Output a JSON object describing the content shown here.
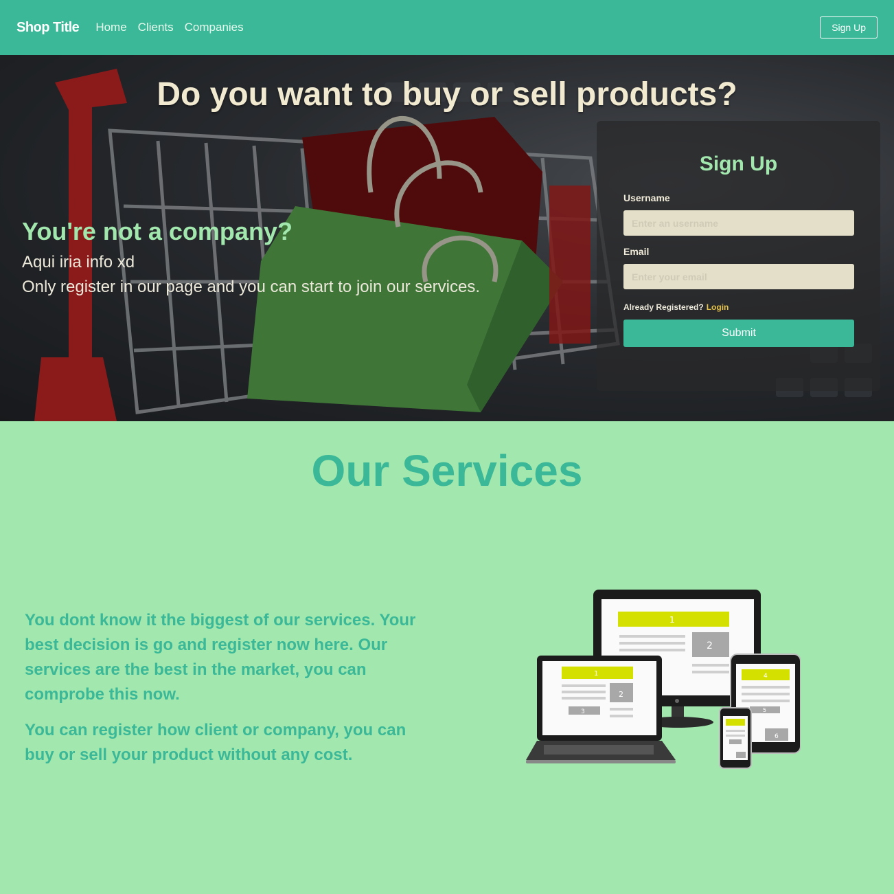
{
  "navbar": {
    "brand": "Shop Title",
    "links": [
      "Home",
      "Clients",
      "Companies"
    ],
    "signup_button": "Sign Up"
  },
  "hero": {
    "title": "Do you want to buy or sell products?",
    "company_heading": "You're not a company?",
    "info_line_1": "Aqui iria info xd",
    "info_line_2": "Only register in our page and you can start to join our services."
  },
  "signup_form": {
    "title": "Sign Up",
    "username_label": "Username",
    "username_placeholder": "Enter an username",
    "email_label": "Email",
    "email_placeholder": "Enter your email",
    "already_registered": "Already Registered?",
    "login_link": "Login",
    "submit_label": "Submit"
  },
  "services": {
    "title": "Our Services",
    "paragraph_1": "You dont know it the biggest of our services. Your best decision is go and register now here. Our services are the best in the market, you can comprobe this now.",
    "paragraph_2": "You can register how client or company, you can buy or sell your product without any cost."
  },
  "colors": {
    "primary": "#3bb897",
    "light_green": "#a2e8ae",
    "cream": "#f2ead0",
    "accent_yellow": "#e6c34a",
    "device_highlight": "#d4e000"
  }
}
